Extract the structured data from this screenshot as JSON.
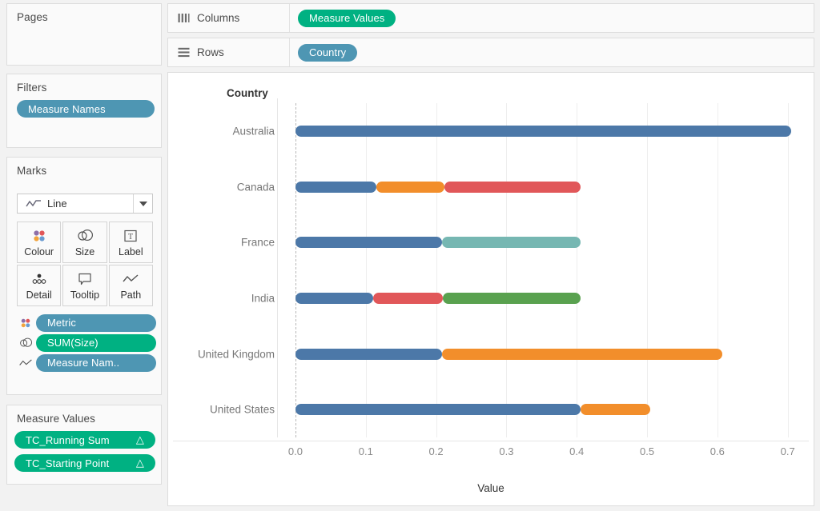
{
  "pages": {
    "title": "Pages"
  },
  "filters": {
    "title": "Filters",
    "pills": [
      {
        "label": "Measure Names",
        "color": "#4e96b3"
      }
    ]
  },
  "marks": {
    "title": "Marks",
    "mark_type": "Line",
    "mark_type_icon": "line-icon",
    "buttons": [
      {
        "label": "Colour",
        "icon": "colour-icon"
      },
      {
        "label": "Size",
        "icon": "size-icon"
      },
      {
        "label": "Label",
        "icon": "label-icon"
      },
      {
        "label": "Detail",
        "icon": "detail-icon"
      },
      {
        "label": "Tooltip",
        "icon": "tooltip-icon"
      },
      {
        "label": "Path",
        "icon": "path-icon"
      }
    ],
    "assigned": [
      {
        "icon": "colour-icon",
        "label": "Metric",
        "color": "#4e96b3"
      },
      {
        "icon": "size-icon",
        "label": "SUM(Size)",
        "color": "#00b182"
      },
      {
        "icon": "path-icon",
        "label": "Measure Nam..",
        "color": "#4e96b3"
      }
    ]
  },
  "measure_values": {
    "title": "Measure Values",
    "pills": [
      {
        "label": "TC_Running Sum",
        "suffix": "△",
        "color": "#00b182"
      },
      {
        "label": "TC_Starting Point",
        "suffix": "△",
        "color": "#00b182"
      }
    ]
  },
  "shelves": {
    "columns": {
      "label": "Columns",
      "icon": "columns-icon",
      "pill": "Measure Values",
      "pill_color": "#00b182"
    },
    "rows": {
      "label": "Rows",
      "icon": "rows-icon",
      "pill": "Country",
      "pill_color": "#4e96b3"
    }
  },
  "chart_data": {
    "type": "bar",
    "title": "",
    "row_header": "Country",
    "xlabel": "Value",
    "ylabel": "Country",
    "xlim": [
      -0.025,
      0.73
    ],
    "xticks": [
      "0.0",
      "0.1",
      "0.2",
      "0.3",
      "0.4",
      "0.5",
      "0.6",
      "0.7"
    ],
    "xtick_values": [
      0.0,
      0.1,
      0.2,
      0.3,
      0.4,
      0.5,
      0.6,
      0.7
    ],
    "grid": true,
    "legend_position": "none",
    "categories": [
      "Australia",
      "Canada",
      "France",
      "India",
      "United Kingdom",
      "United States"
    ],
    "series": [
      {
        "name": "blue",
        "color": "#4c78a8"
      },
      {
        "name": "orange",
        "color": "#f28e2b"
      },
      {
        "name": "red",
        "color": "#e15759"
      },
      {
        "name": "teal",
        "color": "#76b7b2"
      },
      {
        "name": "green",
        "color": "#59a14f"
      }
    ],
    "bars": [
      {
        "category": "Australia",
        "segments": [
          {
            "color": "#4c78a8",
            "start": 0.0,
            "end": 0.705
          }
        ]
      },
      {
        "category": "Canada",
        "segments": [
          {
            "color": "#4c78a8",
            "start": 0.0,
            "end": 0.115
          },
          {
            "color": "#f28e2b",
            "start": 0.115,
            "end": 0.212
          },
          {
            "color": "#e15759",
            "start": 0.212,
            "end": 0.405
          }
        ]
      },
      {
        "category": "France",
        "segments": [
          {
            "color": "#4c78a8",
            "start": 0.0,
            "end": 0.208
          },
          {
            "color": "#76b7b2",
            "start": 0.208,
            "end": 0.405
          }
        ]
      },
      {
        "category": "India",
        "segments": [
          {
            "color": "#4c78a8",
            "start": 0.0,
            "end": 0.11
          },
          {
            "color": "#e15759",
            "start": 0.11,
            "end": 0.21
          },
          {
            "color": "#59a14f",
            "start": 0.21,
            "end": 0.405
          }
        ]
      },
      {
        "category": "United Kingdom",
        "segments": [
          {
            "color": "#4c78a8",
            "start": 0.0,
            "end": 0.208
          },
          {
            "color": "#f28e2b",
            "start": 0.208,
            "end": 0.607
          }
        ]
      },
      {
        "category": "United States",
        "segments": [
          {
            "color": "#4c78a8",
            "start": 0.0,
            "end": 0.405
          },
          {
            "color": "#f28e2b",
            "start": 0.405,
            "end": 0.505
          }
        ]
      }
    ]
  }
}
